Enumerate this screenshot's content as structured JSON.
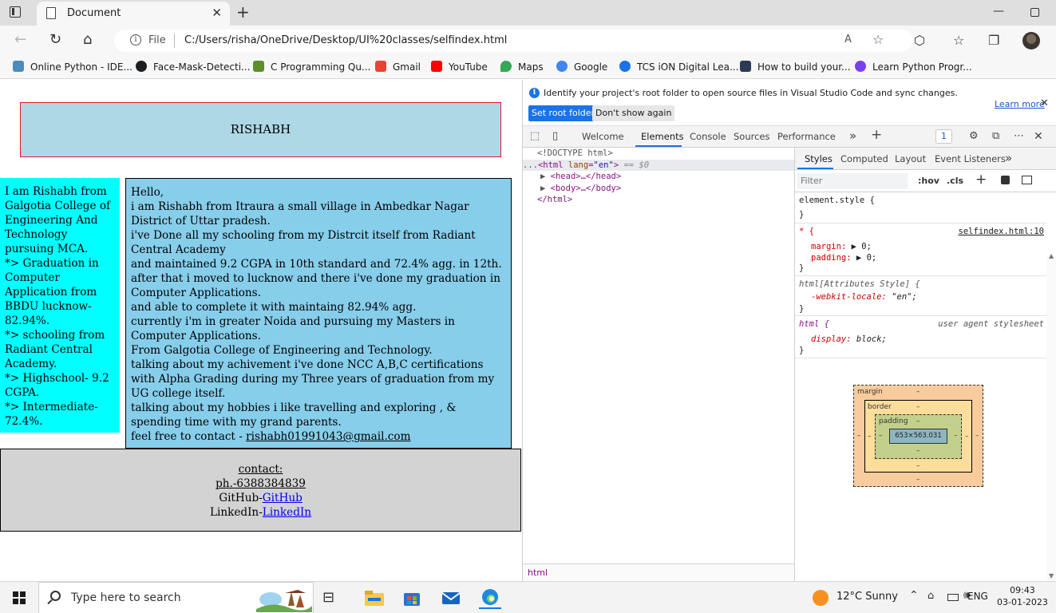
{
  "browser": {
    "tab_title": "Document",
    "address_label": "File",
    "url": "C:/Users/risha/OneDrive/Desktop/UI%20classes/selfindex.html",
    "bookmarks": [
      {
        "label": "Online Python - IDE...",
        "icon": "python-icon",
        "color": "#4b8bbe"
      },
      {
        "label": "Face-Mask-Detecti...",
        "icon": "github-icon",
        "color": "#1b1f23"
      },
      {
        "label": "C Programming Qu...",
        "icon": "bird-icon",
        "color": "#5a8f29"
      },
      {
        "label": "Gmail",
        "icon": "gmail-icon",
        "color": "#ea4335"
      },
      {
        "label": "YouTube",
        "icon": "youtube-icon",
        "color": "#ff0000"
      },
      {
        "label": "Maps",
        "icon": "maps-icon",
        "color": "#34a853"
      },
      {
        "label": "Google",
        "icon": "google-icon",
        "color": "#4285f4"
      },
      {
        "label": "TCS iON Digital Lea...",
        "icon": "tcs-icon",
        "color": "#1a73e8"
      },
      {
        "label": "How to build your...",
        "icon": "tds-icon",
        "color": "#2b3a55"
      },
      {
        "label": "Learn Python Progr...",
        "icon": "learn-python-icon",
        "color": "#7b3ff2"
      }
    ]
  },
  "page": {
    "header_title": "RISHABH",
    "sidebar_lines": [
      "I am Rishabh from Galgotia College of Engineering And Technology pursuing MCA.",
      "*> Graduation in Computer Application from BBDU lucknow- 82.94%.",
      "*> schooling from Radiant Central Academy.",
      "*> Highschool- 9.2 CGPA.",
      "*> Intermediate- 72.4%."
    ],
    "main_lines": [
      "Hello,",
      "i am Rishabh from Itraura a small village in Ambedkar Nagar District of Uttar pradesh.",
      "i've Done all my schooling from my Distrcit itself from Radiant Central Academy",
      "and maintained 9.2 CGPA in 10th standard and 72.4% agg. in 12th.",
      "after that i moved to lucknow and there i've done my graduation in Computer Applications.",
      "and able to complete it with maintaing 82.94% agg.",
      "currently i'm in greater Noida and pursuing my Masters in Computer Applications.",
      "From Galgotia College of Engineering and Technology.",
      "talking about my achivement i've done NCC A,B,C certifications with Alpha Grading during my Three years of graduation from my UG college itself.",
      "talking about my hobbies i like travelling and exploring , & spending time with my grand parents."
    ],
    "contact_prefix": "feel free to contact - ",
    "contact_email": "rishabh01991043@gmail.com",
    "footer": {
      "contact_label": "contact:",
      "phone": "ph.-6388384839",
      "github_prefix": "GitHub-",
      "github_link": "GitHub",
      "linkedin_prefix": "LinkedIn-",
      "linkedin_link": "LinkedIn"
    }
  },
  "devtools": {
    "info_message": "Identify your project's root folder to open source files in Visual Studio Code and sync changes.",
    "set_root_button": "Set root folder",
    "dont_show_button": "Don't show again",
    "learn_more": "Learn more",
    "tabs": [
      "Welcome",
      "Elements",
      "Console",
      "Sources",
      "Performance"
    ],
    "active_tab": "Elements",
    "issues_count": "1",
    "dom": {
      "doctype": "<!DOCTYPE html>",
      "html_open_tag": "<html",
      "html_attr_name": "lang",
      "html_attr_value": "\"en\"",
      "html_open_close": ">",
      "selected_marker": "== $0",
      "head": "<head>…</head>",
      "body": "<body>…</body>",
      "html_close": "</html>",
      "dots": "..."
    },
    "breadcrumb": "html",
    "styles_tabs": [
      "Styles",
      "Computed",
      "Layout",
      "Event Listeners"
    ],
    "filter_placeholder": "Filter",
    "hov": ":hov",
    "cls": ".cls",
    "rules": {
      "element_style": "element.style {",
      "close_brace": "}",
      "star_selector": "* {",
      "star_source": "selfindex.html:10",
      "margin_prop": "margin",
      "margin_val": "▶ 0;",
      "padding_prop": "padding",
      "padding_val": "▶ 0;",
      "attr_selector": "html[Attributes Style] {",
      "locale_prop": "-webkit-locale",
      "locale_val": "\"en\";",
      "html_selector": "html {",
      "ua_label": "user agent stylesheet",
      "display_prop": "display",
      "display_val": "block;"
    },
    "box_model": {
      "margin_label": "margin",
      "border_label": "border",
      "padding_label": "padding",
      "dash": "–",
      "content_size": "653×563.031"
    }
  },
  "taskbar": {
    "search_placeholder": "Type here to search",
    "weather": "12°C  Sunny",
    "language": "ENG",
    "time": "09:43",
    "date": "03-01-2023"
  }
}
